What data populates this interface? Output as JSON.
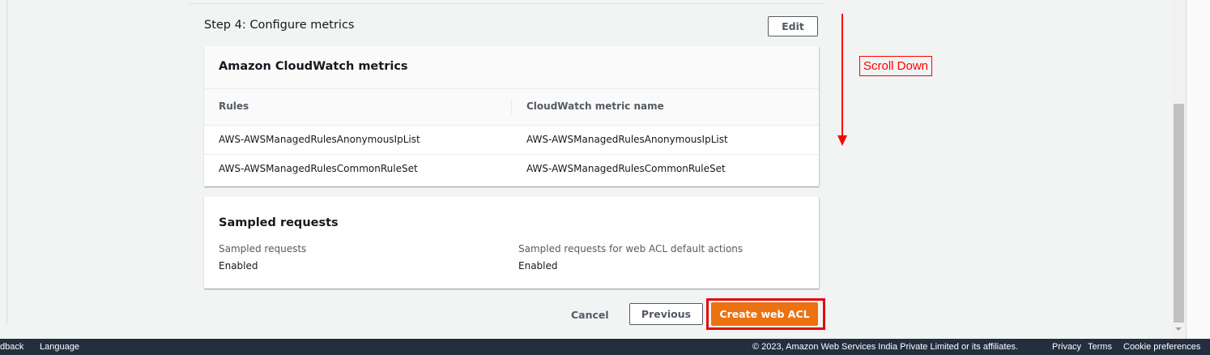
{
  "step": {
    "title": "Step 4: Configure metrics",
    "edit_label": "Edit"
  },
  "metrics": {
    "title": "Amazon CloudWatch metrics",
    "columns": [
      "Rules",
      "CloudWatch metric name"
    ],
    "rows": [
      [
        "AWS-AWSManagedRulesAnonymousIpList",
        "AWS-AWSManagedRulesAnonymousIpList"
      ],
      [
        "AWS-AWSManagedRulesCommonRuleSet",
        "AWS-AWSManagedRulesCommonRuleSet"
      ]
    ]
  },
  "sampled": {
    "title": "Sampled requests",
    "items": [
      {
        "label": "Sampled requests",
        "value": "Enabled"
      },
      {
        "label": "Sampled requests for web ACL default actions",
        "value": "Enabled"
      }
    ]
  },
  "actions": {
    "cancel_label": "Cancel",
    "previous_label": "Previous",
    "create_label": "Create web ACL"
  },
  "annotation": {
    "scroll_label": "Scroll Down",
    "color": "#ff0000"
  },
  "footer": {
    "feedback": "dback",
    "language": "Language",
    "copyright": "© 2023, Amazon Web Services India Private Limited or its affiliates.",
    "privacy": "Privacy",
    "terms": "Terms",
    "cookie_preferences": "Cookie preferences"
  },
  "colors": {
    "primary_button": "#ec7211",
    "highlight": "#e4080a",
    "footer_bg": "#232f3e"
  }
}
